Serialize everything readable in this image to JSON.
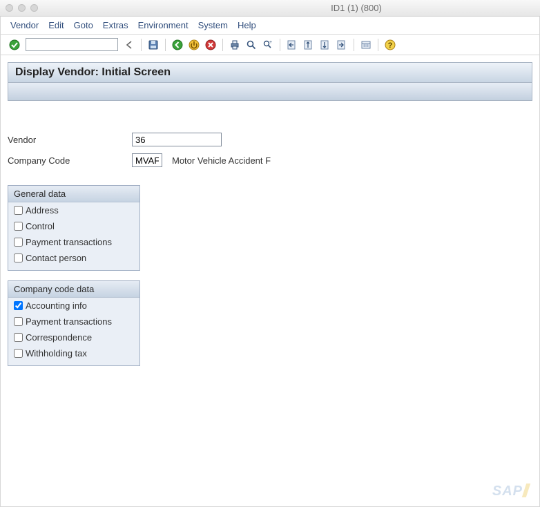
{
  "window": {
    "title": "ID1 (1) (800)"
  },
  "menu": {
    "items": [
      "Vendor",
      "Edit",
      "Goto",
      "Extras",
      "Environment",
      "System",
      "Help"
    ]
  },
  "toolbar": {
    "command_value": "",
    "icons": {
      "enter": "enter-icon",
      "history": "history-icon",
      "save": "save-icon",
      "back": "back-icon",
      "exit": "exit-icon",
      "cancel": "cancel-icon",
      "print": "print-icon",
      "find": "find-icon",
      "find_next": "find-next-icon",
      "first": "first-page-icon",
      "prev": "prev-page-icon",
      "next": "next-page-icon",
      "last": "last-page-icon",
      "new_session": "new-session-icon",
      "help": "help-icon"
    }
  },
  "screen": {
    "title": "Display Vendor:  Initial Screen"
  },
  "form": {
    "vendor": {
      "label": "Vendor",
      "value": "36"
    },
    "company_code": {
      "label": "Company Code",
      "value": "MVAF",
      "description": "Motor Vehicle Accident F"
    }
  },
  "groups": {
    "general": {
      "title": "General data",
      "items": [
        {
          "label": "Address",
          "checked": false
        },
        {
          "label": "Control",
          "checked": false
        },
        {
          "label": "Payment transactions",
          "checked": false
        },
        {
          "label": "Contact person",
          "checked": false
        }
      ]
    },
    "ccode": {
      "title": "Company code data",
      "items": [
        {
          "label": "Accounting info",
          "checked": true
        },
        {
          "label": "Payment transactions",
          "checked": false
        },
        {
          "label": "Correspondence",
          "checked": false
        },
        {
          "label": "Withholding tax",
          "checked": false
        }
      ]
    }
  },
  "footer": {
    "logo": "SAP"
  }
}
